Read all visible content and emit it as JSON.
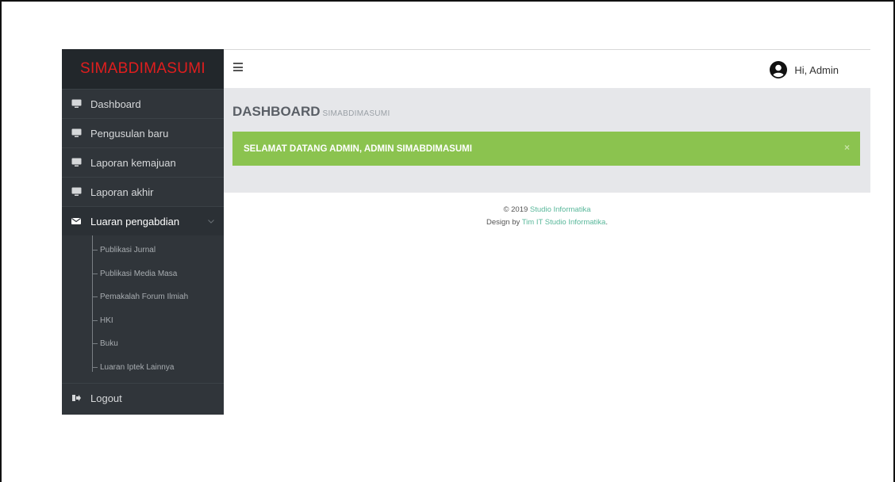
{
  "brand": "SIMABDIMASUMI",
  "sidebar": {
    "items": [
      {
        "label": "Dashboard",
        "icon": "monitor-icon"
      },
      {
        "label": "Pengusulan baru",
        "icon": "monitor-icon"
      },
      {
        "label": "Laporan kemajuan",
        "icon": "monitor-icon"
      },
      {
        "label": "Laporan akhir",
        "icon": "monitor-icon"
      },
      {
        "label": "Luaran pengabdian",
        "icon": "envelope-icon",
        "expanded": true
      }
    ],
    "submenu": [
      "Publikasi Jurnal",
      "Publikasi Media Masa",
      "Pemakalah Forum Ilmiah",
      "HKI",
      "Buku",
      "Luaran Iptek Lainnya"
    ],
    "logout": {
      "label": "Logout",
      "icon": "sign-out-icon"
    }
  },
  "header": {
    "menu_icon": "hamburger-icon",
    "user_icon": "user-circle-icon",
    "greeting": "Hi, Admin"
  },
  "page": {
    "title": "DASHBOARD",
    "subtitle": "SIMABDIMASUMI"
  },
  "alert": {
    "message": "SELAMAT DATANG ADMIN, ADMIN SIMABDIMASUMI",
    "close": "×"
  },
  "footer": {
    "copyright_prefix": "© 2019 ",
    "copyright_link": "Studio Informatika",
    "design_prefix": "Design by ",
    "design_link": "Tim IT Studio Informatika",
    "design_suffix": "."
  },
  "colors": {
    "brand": "#e01e1e",
    "sidebar_bg": "#30353a",
    "alert_bg": "#8bc34f",
    "link": "#58b79a"
  }
}
